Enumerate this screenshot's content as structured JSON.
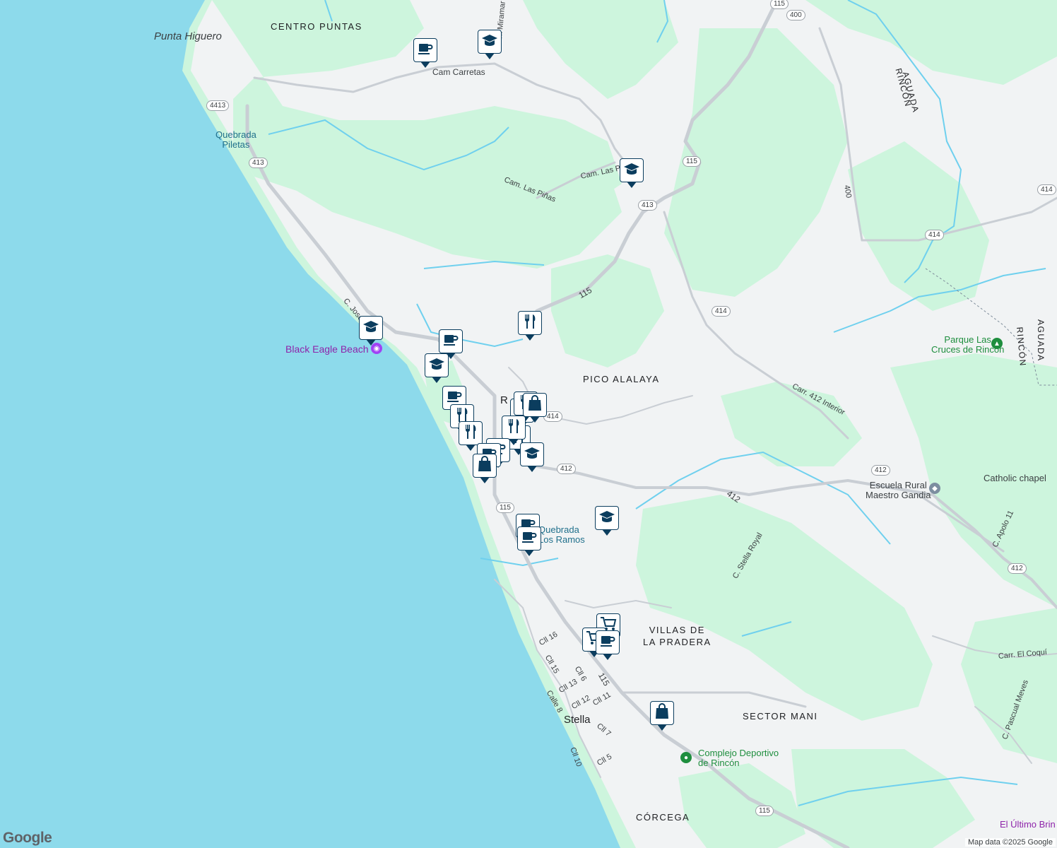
{
  "map": {
    "colors": {
      "ocean": "#8ddaeb",
      "land": "#f1f3f4",
      "forest": "#cdf5dd",
      "road": "#c9ced4",
      "river": "#6fd0ee",
      "marker_fill": "#0b3d5e"
    },
    "labels": {
      "punta_higuero": "Punta Higuero",
      "centro_puntas": "CENTRO PUNTAS",
      "quebrada_piletas": "Quebrada\nPiletas",
      "black_eagle_beach": "Black Eagle Beach",
      "pico_alalaya": "PICO ALALAYA",
      "quebrada_ramos": "Quebrada\nLos Ramos",
      "villas_pradera": "VILLAS DE\nLA PRADERA",
      "stella": "Stella",
      "sector_mani": "SECTOR MANI",
      "corcega": "CÓRCEGA",
      "complejo": "Complejo Deportivo\nde Rincón",
      "escuela": "Escuela Rural\nMaestro Gandia",
      "catholic_chapel": "Catholic chapel",
      "parque_cruces": "Parque Las\nCruces de Rincón",
      "aguada_1": "AGUADA",
      "rincon_1": "RINCÓN",
      "aguada_2": "AGUADA",
      "rincon_2": "RINCÓN",
      "el_ultimo": "El Último Brin",
      "rincon_town": "R"
    },
    "streets": {
      "cam_carretas": "Cam Carretas",
      "cam_miramar": "Cam Miramar",
      "cam_las_pinas": "Cam. Las Piñas",
      "cam_las_pinas_2": "Cam. Las Piñas",
      "c_jose": "C. Jose P",
      "r115_a": "115",
      "r412_a": "412",
      "r115_b": "115",
      "carr_412_interior": "Carr. 412 Interior",
      "c_stella_royal": "C. Stella Royal",
      "c_apolo": "C. Apolo 11",
      "carr_el_coqui": "Carr. El Coquí",
      "c_pascual": "C. Pascual Meves",
      "cll16": "Cll 16",
      "cll15": "Cll 15",
      "cll6": "Cll 6",
      "cll13": "Cll 13",
      "cll12": "Cll 12",
      "cll11": "Cll 11",
      "calle8": "Calle 8",
      "cll7": "Cll 7",
      "cll10": "Cll 10",
      "cll5": "Cll 5",
      "r400": "400"
    },
    "shields": [
      "115",
      "400",
      "4413",
      "413",
      "115",
      "413",
      "414",
      "414",
      "414",
      "414",
      "412",
      "412",
      "115",
      "412",
      "115"
    ],
    "markers": [
      {
        "icon": "coffee-icon"
      },
      {
        "icon": "school-icon"
      },
      {
        "icon": "school-icon"
      },
      {
        "icon": "restaurant-icon"
      },
      {
        "icon": "school-icon"
      },
      {
        "icon": "coffee-icon"
      },
      {
        "icon": "school-icon"
      },
      {
        "icon": "coffee-icon"
      },
      {
        "icon": "restaurant-icon"
      },
      {
        "icon": "restaurant-icon"
      },
      {
        "icon": "restaurant-icon"
      },
      {
        "icon": "restaurant-icon"
      },
      {
        "icon": "shopping-bag-icon"
      },
      {
        "icon": "restaurant-icon"
      },
      {
        "icon": "restaurant-icon"
      },
      {
        "icon": "coffee-icon"
      },
      {
        "icon": "coffee-icon"
      },
      {
        "icon": "shopping-bag-icon"
      },
      {
        "icon": "school-icon"
      },
      {
        "icon": "coffee-icon"
      },
      {
        "icon": "coffee-icon"
      },
      {
        "icon": "school-icon"
      },
      {
        "icon": "cart-icon"
      },
      {
        "icon": "cart-icon"
      },
      {
        "icon": "coffee-icon"
      },
      {
        "icon": "shopping-bag-icon"
      }
    ],
    "attribution": "Map data ©2025 Google",
    "brand": "Google"
  }
}
